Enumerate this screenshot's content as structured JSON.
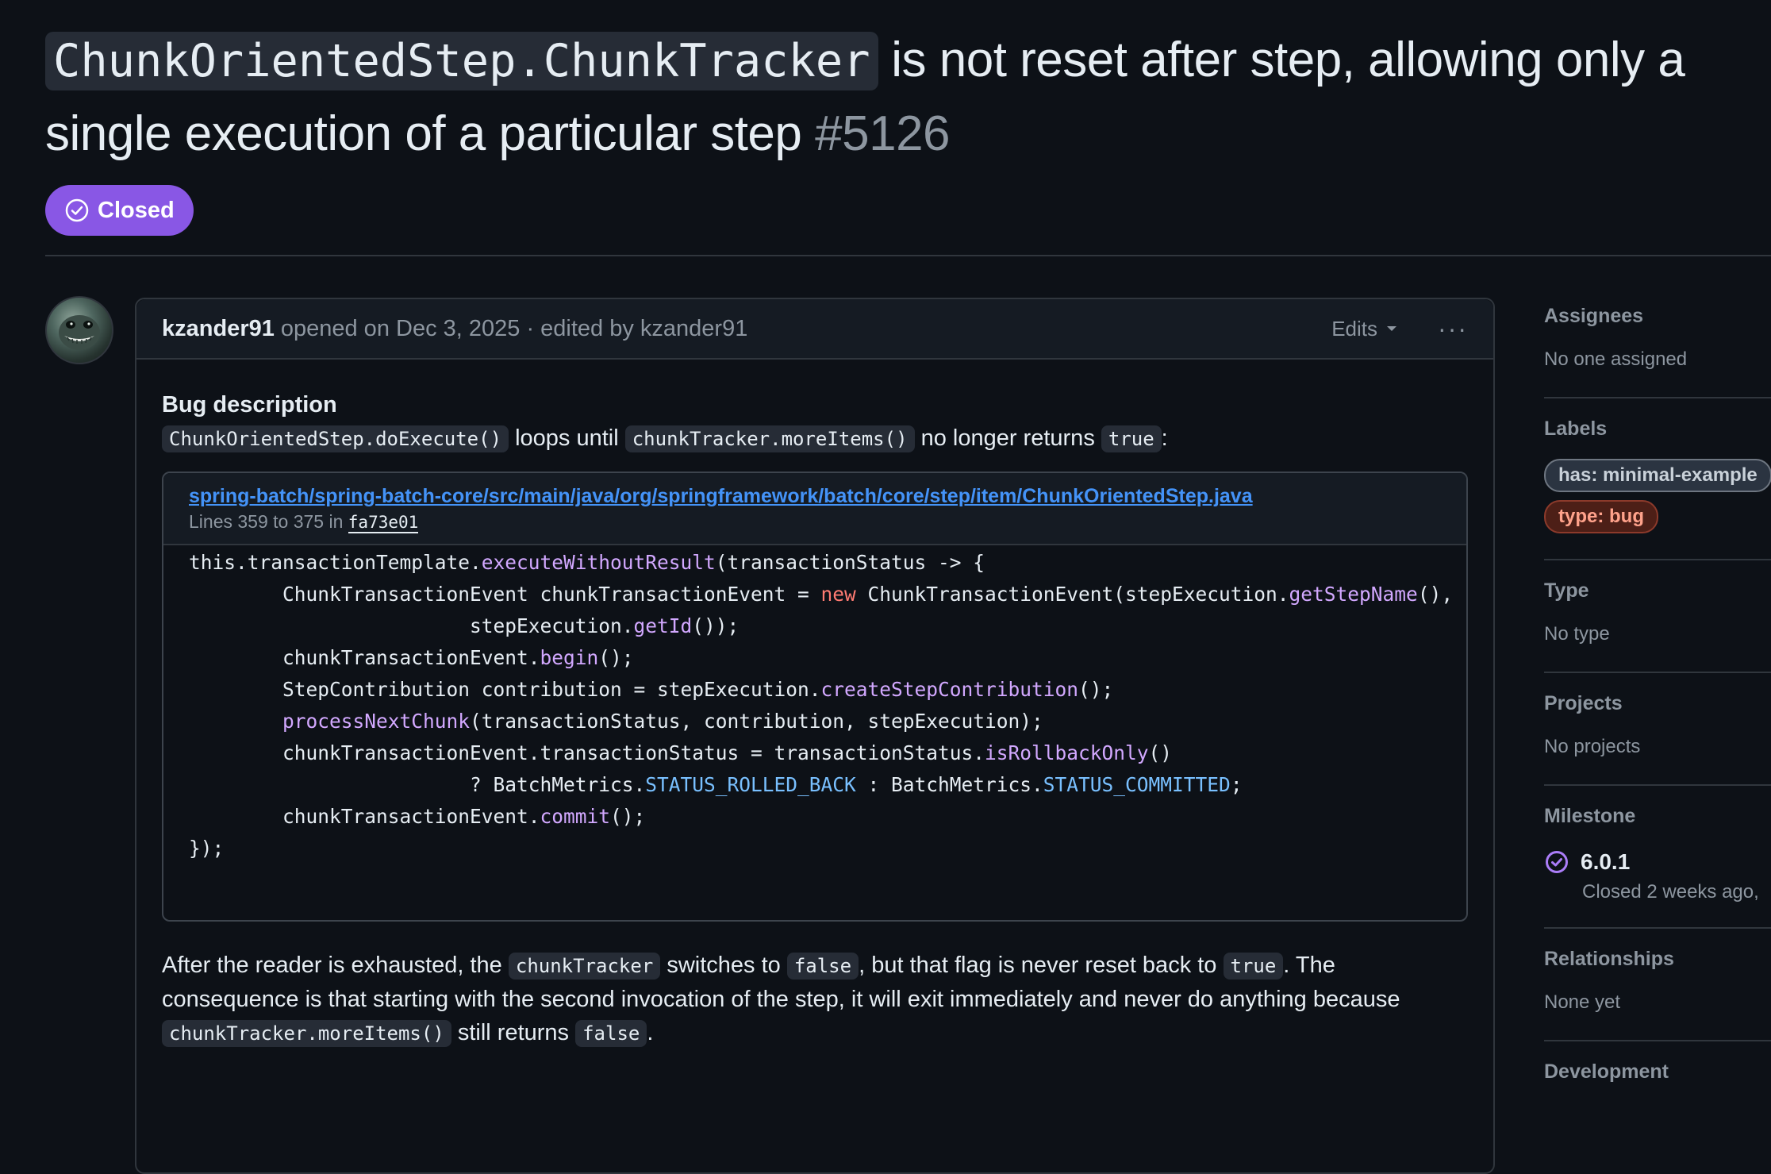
{
  "issue": {
    "title_code": "ChunkOrientedStep.ChunkTracker",
    "title_text": " is not reset after step, allowing only a single execution of a particular step ",
    "number": "#5126",
    "state": "Closed"
  },
  "comment": {
    "author": "kzander91",
    "meta": "opened on Dec 3, 2025 · edited by kzander91",
    "edits_label": "Edits",
    "more_label": "···",
    "heading": "Bug description",
    "intro": {
      "c1": "ChunkOrientedStep.doExecute()",
      "t1": " loops until ",
      "c2": "chunkTracker.moreItems()",
      "t2": " no longer returns ",
      "c3": "true",
      "t3": ":"
    },
    "permalink": {
      "path": "spring-batch/spring-batch-core/src/main/java/org/springframework/batch/core/step/item/ChunkOrientedStep.java",
      "lines_prefix": "Lines 359 to 375 in ",
      "sha": "fa73e01"
    },
    "para": {
      "t1": "After the reader is exhausted, the ",
      "c1": "chunkTracker",
      "t2": " switches to ",
      "c2": "false",
      "t3": ", but that flag is never reset back to ",
      "c3": "true",
      "t4": ". The consequence is that starting with the second invocation of the step, it will exit immediately and never do anything because ",
      "c4": "chunkTracker.moreItems()",
      "t5": " still returns ",
      "c5": "false",
      "t6": "."
    }
  },
  "sidebar": {
    "assignees": {
      "title": "Assignees",
      "value": "No one assigned"
    },
    "labels": {
      "title": "Labels",
      "items": [
        "has: minimal-example",
        "type: bug"
      ]
    },
    "type": {
      "title": "Type",
      "value": "No type"
    },
    "projects": {
      "title": "Projects",
      "value": "No projects"
    },
    "milestone": {
      "title": "Milestone",
      "name": "6.0.1",
      "sub": "Closed 2 weeks ago,"
    },
    "relationships": {
      "title": "Relationships",
      "value": "None yet"
    },
    "development": {
      "title": "Development"
    }
  },
  "colors": {
    "closed": "#8957e5",
    "link": "#4493f8",
    "bg": "#0d1117"
  }
}
